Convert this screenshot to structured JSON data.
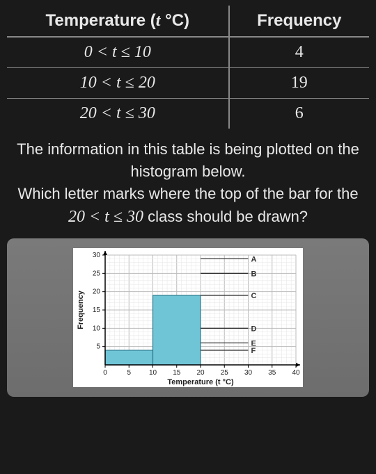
{
  "table": {
    "headers": {
      "left": "Temperature (t °C)",
      "right": "Frequency"
    },
    "rows": [
      {
        "range": "0 < t ≤ 10",
        "freq": "4"
      },
      {
        "range": "10 < t ≤ 20",
        "freq": "19"
      },
      {
        "range": "20 < t ≤ 30",
        "freq": "6"
      }
    ]
  },
  "question": {
    "line1": "The information in this table is being plotted on the histogram below.",
    "line2_pre": "Which letter marks where the top of the bar for the ",
    "class_range": "20 < t ≤ 30",
    "line2_post": " class should be drawn?"
  },
  "chart_data": {
    "type": "bar",
    "xlabel": "Temperature (t °C)",
    "ylabel": "Frequency",
    "xlim": [
      0,
      40
    ],
    "ylim": [
      0,
      30
    ],
    "x_ticks": [
      0,
      5,
      10,
      15,
      20,
      25,
      30,
      35,
      40
    ],
    "y_ticks": [
      5,
      10,
      15,
      20,
      25,
      30
    ],
    "bars": [
      {
        "x0": 0,
        "x1": 10,
        "y": 4
      },
      {
        "x0": 10,
        "x1": 20,
        "y": 19
      }
    ],
    "markers": [
      {
        "label": "A",
        "x0": 20,
        "x1": 30,
        "y": 29
      },
      {
        "label": "B",
        "x0": 20,
        "x1": 30,
        "y": 25
      },
      {
        "label": "C",
        "x0": 20,
        "x1": 30,
        "y": 19
      },
      {
        "label": "D",
        "x0": 20,
        "x1": 30,
        "y": 10
      },
      {
        "label": "E",
        "x0": 20,
        "x1": 30,
        "y": 6
      },
      {
        "label": "F",
        "x0": 20,
        "x1": 30,
        "y": 4
      }
    ]
  }
}
